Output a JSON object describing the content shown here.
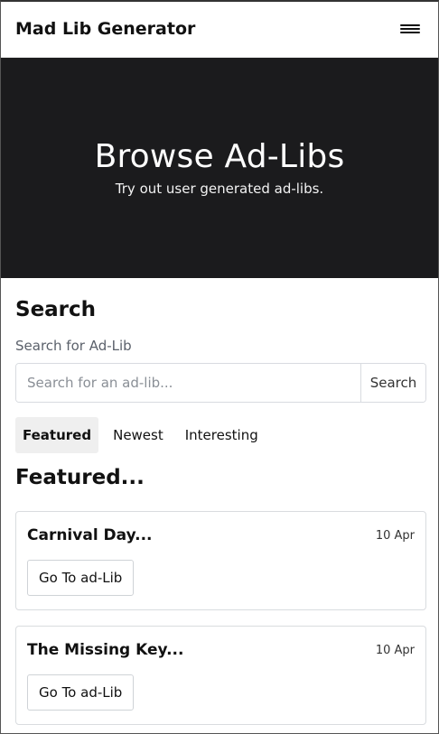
{
  "navbar": {
    "brand": "Mad Lib Generator",
    "menu_icon": "hamburger-icon"
  },
  "hero": {
    "title": "Browse Ad-Libs",
    "subtitle": "Try out user generated ad-libs."
  },
  "search": {
    "heading": "Search",
    "label": "Search for Ad-Lib",
    "placeholder": "Search for an ad-lib...",
    "button": "Search"
  },
  "tabs": [
    {
      "label": "Featured",
      "active": true
    },
    {
      "label": "Newest",
      "active": false
    },
    {
      "label": "Interesting",
      "active": false
    }
  ],
  "list": {
    "heading": "Featured...",
    "cards": [
      {
        "title": "Carnival Day...",
        "date": "10 Apr",
        "button": "Go To ad-Lib"
      },
      {
        "title": "The Missing Key...",
        "date": "10 Apr",
        "button": "Go To ad-Lib"
      }
    ]
  }
}
